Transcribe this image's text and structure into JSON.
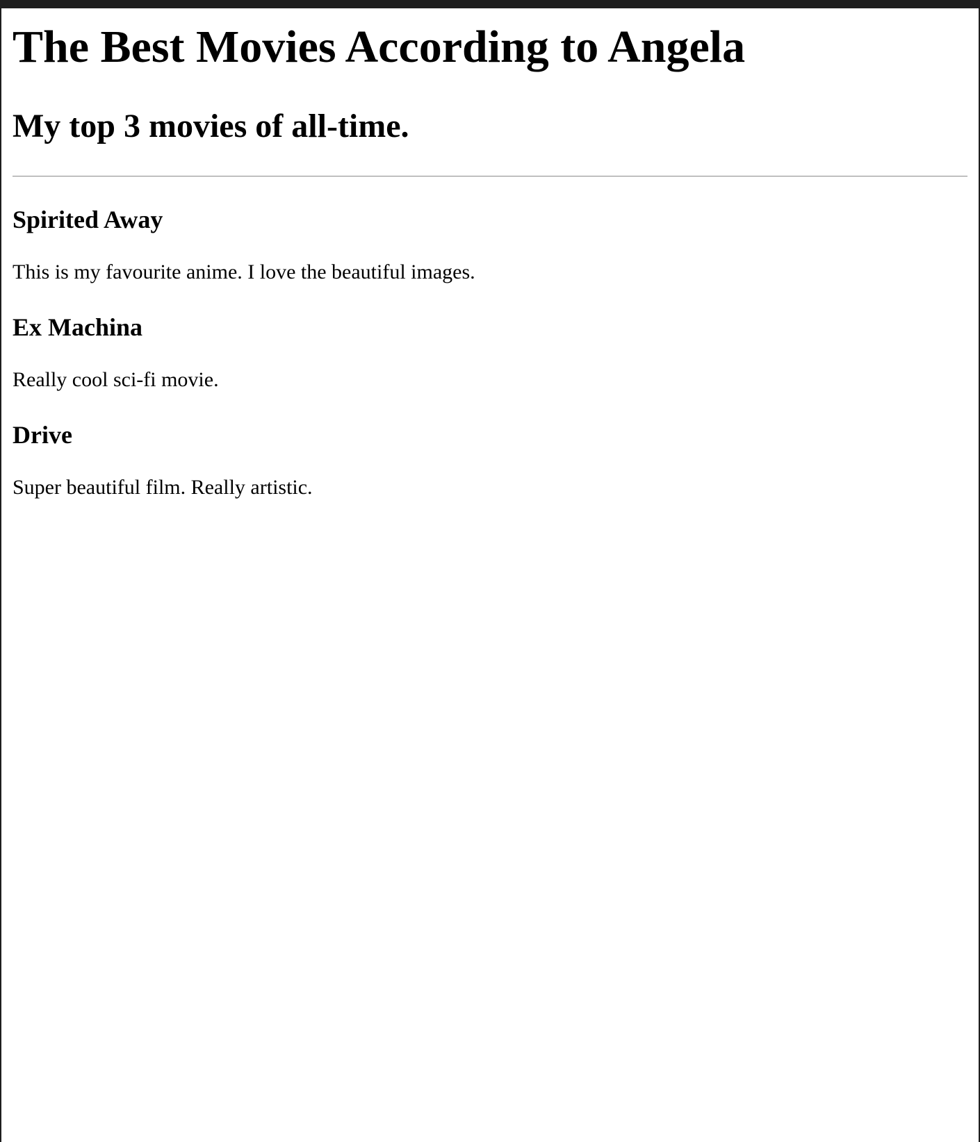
{
  "page": {
    "title": "The Best Movies According to Angela",
    "subtitle": "My top 3 movies of all-time."
  },
  "movies": [
    {
      "title": "Spirited Away",
      "description": "This is my favourite anime. I love the beautiful images."
    },
    {
      "title": "Ex Machina",
      "description": "Really cool sci-fi movie."
    },
    {
      "title": "Drive",
      "description": "Super beautiful film. Really artistic."
    }
  ]
}
